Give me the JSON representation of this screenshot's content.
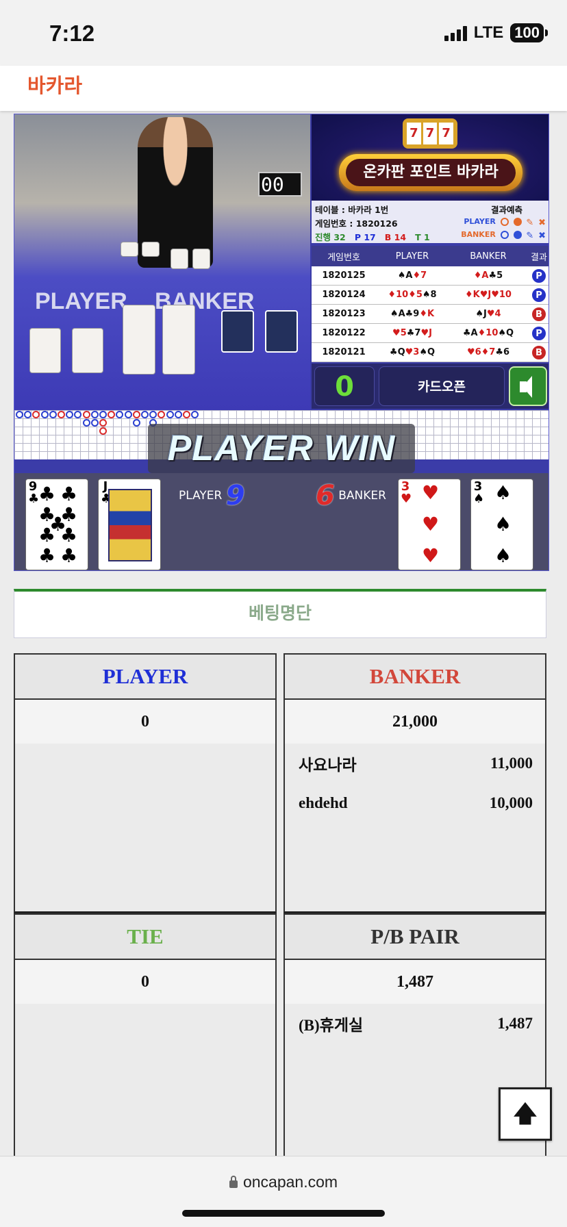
{
  "status_bar": {
    "time": "7:12",
    "network": "LTE",
    "battery": "100"
  },
  "header": {
    "title": "바카라"
  },
  "game": {
    "video": {
      "timer": "00",
      "table_label_player": "PLAYER",
      "table_label_banker": "BANKER"
    },
    "promo": {
      "title": "온카판 포인트 바카라",
      "slot": [
        "7",
        "7",
        "7"
      ]
    },
    "info": {
      "table": "테이블 : 바카라 1번",
      "game_number": "게임번호 : 1820126",
      "progress_label": "진행 32",
      "p_count": "P 17",
      "b_count": "B 14",
      "t_count": "T 1",
      "prediction_label": "결과예측",
      "pred_player": "PLAYER",
      "pred_banker": "BANKER"
    },
    "history": {
      "headers": [
        "게임번호",
        "PLAYER",
        "BANKER",
        "결과"
      ],
      "rows": [
        {
          "no": "1820125",
          "player": "♠A♦7",
          "banker": "♦A♣5",
          "result": "P"
        },
        {
          "no": "1820124",
          "player": "♦10♦5♠8",
          "banker": "♦K♥J♥10",
          "result": "P"
        },
        {
          "no": "1820123",
          "player": "♠A♣9♦K",
          "banker": "♠J♥4",
          "result": "B"
        },
        {
          "no": "1820122",
          "player": "♥5♣7♥J",
          "banker": "♣A♦10♠Q",
          "result": "P"
        },
        {
          "no": "1820121",
          "player": "♣Q♥3♠Q",
          "banker": "♥6♦7♣6",
          "result": "B"
        }
      ]
    },
    "controls": {
      "count": "0",
      "card_open": "카드오픈"
    },
    "win_banner": "PLAYER WIN",
    "result": {
      "player_label": "PLAYER",
      "player_score": "9",
      "banker_label": "BANKER",
      "banker_score": "6",
      "player_cards": [
        {
          "rank": "9",
          "suit": "♣"
        },
        {
          "rank": "J",
          "suit": "♣"
        }
      ],
      "banker_cards": [
        {
          "rank": "3",
          "suit": "♥"
        },
        {
          "rank": "3",
          "suit": "♠"
        }
      ]
    }
  },
  "betting": {
    "title": "베팅명단",
    "player": {
      "label": "PLAYER",
      "color": "#1f2fd6",
      "total": "0",
      "entries": []
    },
    "banker": {
      "label": "BANKER",
      "color": "#d2473a",
      "total": "21,000",
      "entries": [
        {
          "name": "사요나라",
          "amount": "11,000"
        },
        {
          "name": "ehdehd",
          "amount": "10,000"
        }
      ]
    },
    "tie": {
      "label": "TIE",
      "color": "#6ab04c",
      "total": "0",
      "entries": []
    },
    "pair": {
      "label": "P/B PAIR",
      "color": "#333333",
      "total": "1,487",
      "entries": [
        {
          "name": "(B)휴게실",
          "amount": "1,487"
        }
      ]
    }
  },
  "scroll_top_icon": "arrow-up-icon",
  "url_bar": {
    "domain": "oncapan.com"
  }
}
